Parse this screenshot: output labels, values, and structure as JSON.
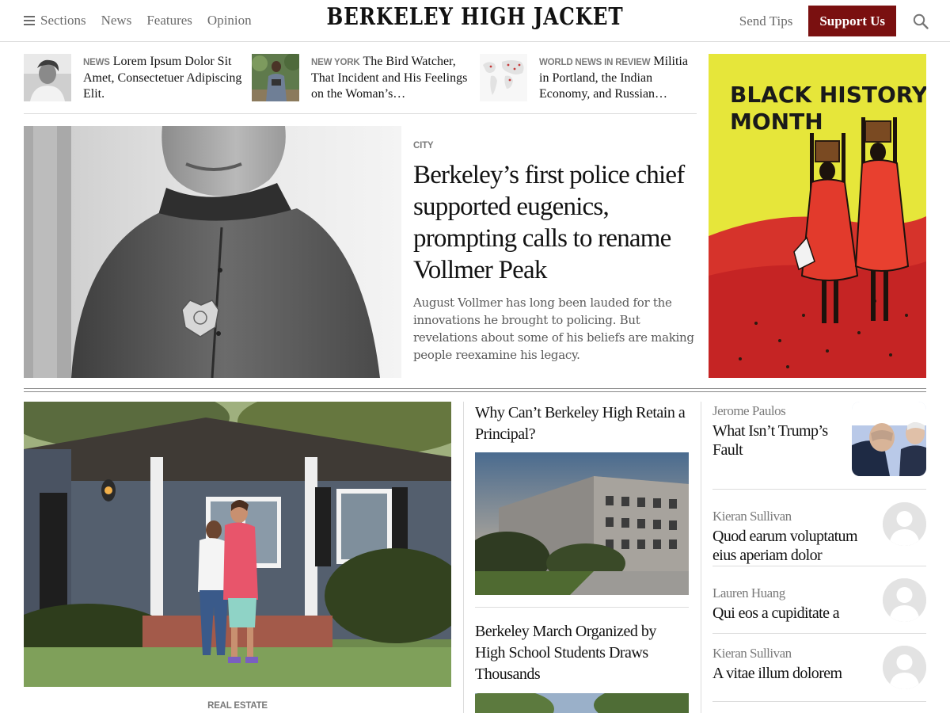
{
  "header": {
    "sections_label": "Sections",
    "nav": [
      "News",
      "Features",
      "Opinion"
    ],
    "masthead": "BERKELEY HIGH JACKET",
    "send_tips": "Send Tips",
    "support": "Support Us",
    "accent_color": "#7a1010"
  },
  "strip": [
    {
      "kicker": "NEWS",
      "title": "Lorem Ipsum Dolor Sit Amet, Consectetuer Adipiscing Elit."
    },
    {
      "kicker": "NEW YORK",
      "title": "The Bird Watcher, That Incident and His Feelings on the Woman’s…"
    },
    {
      "kicker": "WORLD NEWS IN REVIEW",
      "title": "Militia in Portland, the Indian Economy, and Russian…"
    }
  ],
  "lead": {
    "section": "CITY",
    "headline": "Berkeley’s first police chief supported eugenics, prompting calls to rename Vollmer Peak",
    "summary": "August Vollmer has long been lauded for the innovations he brought to policing. But revelations about some of his beliefs are making people reexamine his legacy."
  },
  "ad": {
    "text_line1": "BLACK HISTORY",
    "text_line2": "MONTH"
  },
  "bottom": {
    "feature_label": "REAL ESTATE",
    "mid_stories": [
      {
        "headline": "Why Can’t Berkeley High Retain a Principal?"
      },
      {
        "headline": "Berkeley March Organized by High School Students Draws Thousands"
      }
    ],
    "opinion": [
      {
        "author": "Jerome Paulos",
        "title": "What Isn’t Trump’s Fault"
      },
      {
        "author": "Kieran Sullivan",
        "title": "Quod earum voluptatum eius aperiam dolor"
      },
      {
        "author": "Lauren Huang",
        "title": "Qui eos a cupiditate a"
      },
      {
        "author": "Kieran Sullivan",
        "title": "A vitae illum dolorem"
      }
    ]
  }
}
